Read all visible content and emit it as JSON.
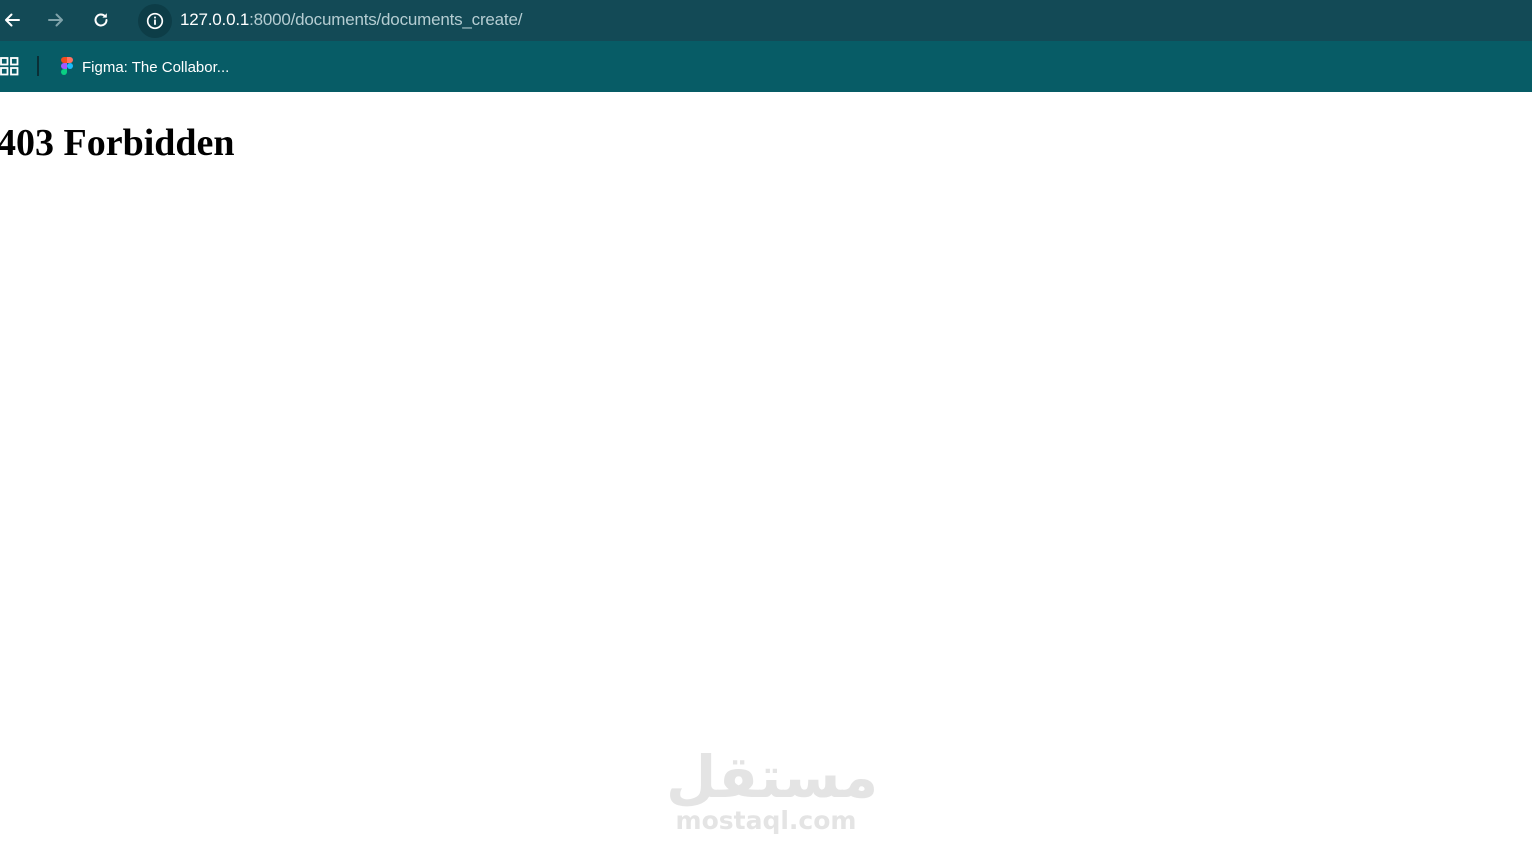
{
  "browser": {
    "toolbar_color": "#134a56",
    "bookmarks_bar_color": "#075c66",
    "nav": {
      "back_icon": "arrow-left-icon",
      "forward_icon": "arrow-right-icon",
      "reload_icon": "reload-icon"
    },
    "address_bar": {
      "site_info_icon": "info-icon",
      "url_host": "127.0.0.1",
      "url_rest": ":8000/documents/documents_create/"
    },
    "bookmarks": {
      "apps_icon": "apps-grid-icon",
      "items": [
        {
          "icon": "figma-icon",
          "label": "Figma: The Collabor..."
        }
      ]
    }
  },
  "page": {
    "heading": "403 Forbidden"
  },
  "watermark": {
    "arabic": "مستقل",
    "latin": "mostaql.com"
  }
}
